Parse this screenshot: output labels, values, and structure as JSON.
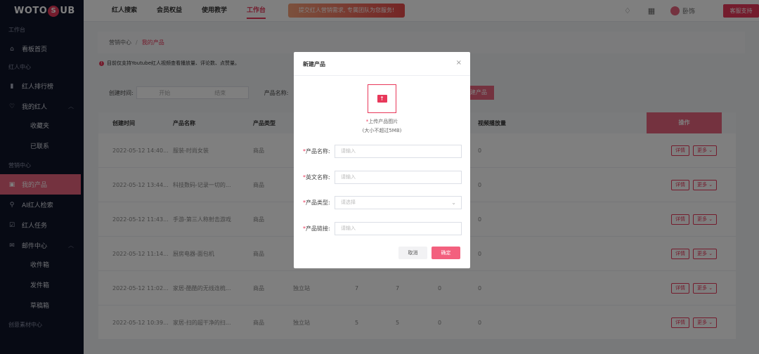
{
  "brand": {
    "logo_left": "WOTO",
    "logo_mid": "S",
    "logo_right": "UB"
  },
  "sidebar": {
    "sections": [
      "工作台",
      "红人中心",
      "营销中心",
      "创意素材中心"
    ],
    "items": [
      {
        "label": "看板首页",
        "icon": "home-icon"
      },
      {
        "label": "红人排行榜",
        "icon": "bar-chart-icon"
      },
      {
        "label": "我的红人",
        "icon": "heart-icon"
      },
      {
        "label": "收藏夹"
      },
      {
        "label": "已联系"
      },
      {
        "label": "我的产品",
        "icon": "box-icon"
      },
      {
        "label": "AI红人检索",
        "icon": "user-search-icon"
      },
      {
        "label": "红人任务",
        "icon": "checkbox-icon"
      },
      {
        "label": "邮件中心",
        "icon": "mail-icon"
      },
      {
        "label": "收件箱"
      },
      {
        "label": "发件箱"
      },
      {
        "label": "草稿箱"
      }
    ]
  },
  "topbar": {
    "nav": [
      "红人搜索",
      "会员权益",
      "使用教学",
      "工作台"
    ],
    "banner": "提交红人营销需求, 专属团队为您服务!",
    "user": "卧饰",
    "support": "客服支持"
  },
  "page": {
    "crumb_root": "营销中心",
    "crumb_sep": "/",
    "crumb_current": "我的产品",
    "notice": "目前仅支持Youtube红人视频查看播放量、评论数、点赞量。",
    "filter_time_label": "创建时间:",
    "date_start": "开始",
    "date_end": "结束",
    "filter_name_label": "产品名称:",
    "new_btn": "建产品"
  },
  "table": {
    "headers": [
      "创建时间",
      "产品名称",
      "产品类型",
      "视频播放量",
      "操作"
    ],
    "rows": [
      {
        "time": "2022-05-12 14:40...",
        "name": "服装-时尚女装",
        "type": "商品",
        "src": "",
        "a": "",
        "b": "",
        "c": "",
        "d": "0"
      },
      {
        "time": "2022-05-12 13:44...",
        "name": "科技数码-记录一切的...",
        "type": "商品",
        "src": "",
        "a": "",
        "b": "",
        "c": "",
        "d": "0"
      },
      {
        "time": "2022-05-12 11:43...",
        "name": "手游-第三人称射击游戏",
        "type": "商品",
        "src": "",
        "a": "",
        "b": "",
        "c": "",
        "d": "0"
      },
      {
        "time": "2022-05-12 11:14...",
        "name": "厨房电器-面包机",
        "type": "商品",
        "src": "",
        "a": "",
        "b": "",
        "c": "",
        "d": "0"
      },
      {
        "time": "2022-05-12 11:02...",
        "name": "家居-酷酷的无线连梳...",
        "type": "商品",
        "src": "独立站",
        "a": "7",
        "b": "7",
        "c": "0",
        "d": "0"
      },
      {
        "time": "2022-05-12 10:39...",
        "name": "家居-扫的超干净的扫...",
        "type": "商品",
        "src": "独立站",
        "a": "5",
        "b": "5",
        "c": "0",
        "d": "0"
      }
    ],
    "detail_btn": "详情",
    "more_btn": "更多"
  },
  "modal": {
    "title": "新建产品",
    "close": "×",
    "upload_label": "上传产品图片",
    "upload_req": "*",
    "upload_hint": "(大小不超过5MB)",
    "fields": [
      {
        "label": "产品名称:",
        "placeholder": "请输入"
      },
      {
        "label": "英文名称:",
        "placeholder": "请输入"
      },
      {
        "label": "产品类型:",
        "placeholder": "请选择"
      },
      {
        "label": "产品链接:",
        "placeholder": "请输入"
      }
    ],
    "req": "*",
    "cancel": "取消",
    "ok": "确定"
  },
  "colors": {
    "accent": "#e8385a",
    "sidebar_bg": "#0f1428"
  }
}
